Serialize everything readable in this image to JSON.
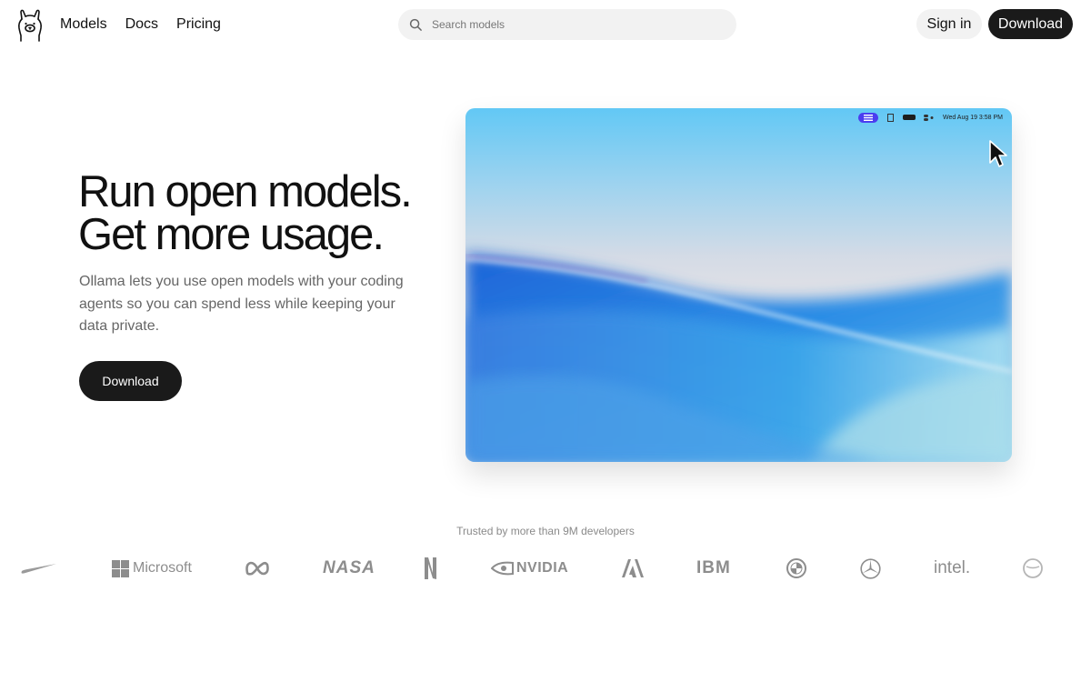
{
  "nav": {
    "links": [
      "Models",
      "Docs",
      "Pricing"
    ],
    "search_placeholder": "Search models",
    "signin_label": "Sign in",
    "download_label": "Download"
  },
  "hero": {
    "headline_line1": "Run open models.",
    "headline_line2": "Get more usage.",
    "subtext": "Ollama lets you use open models with your coding agents so you can spend less while keeping your data private.",
    "download_label": "Download"
  },
  "preview": {
    "menubar_time": "Wed Aug 19  3:58 PM"
  },
  "trusted": {
    "label": "Trusted by more than 9M developers",
    "brands": {
      "microsoft": "Microsoft",
      "nasa": "NASA",
      "nvidia": "NVIDIA",
      "ibm": "IBM",
      "intel": "intel."
    }
  },
  "colors": {
    "primary_button": "#1a1a1a",
    "search_bg": "#f2f2f2",
    "subtext": "#666666",
    "logo_gray": "#8d8d8d"
  }
}
